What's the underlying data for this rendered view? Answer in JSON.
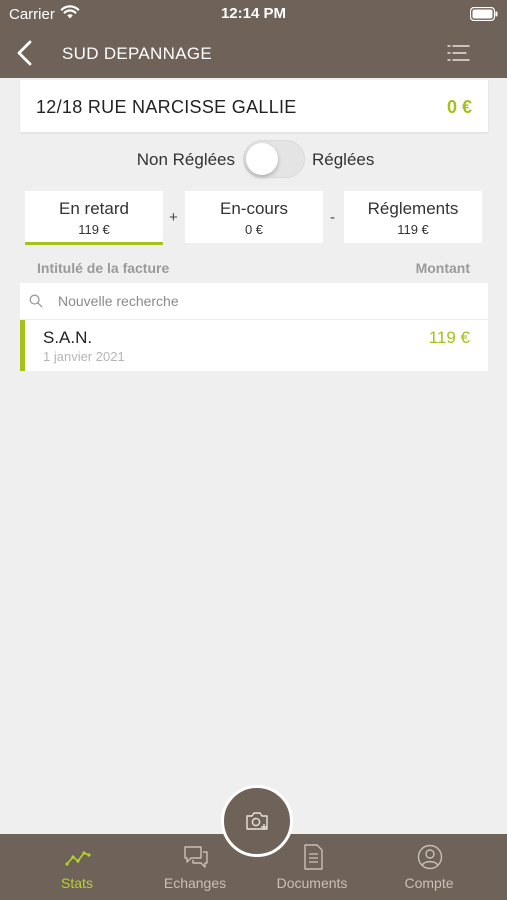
{
  "status_bar": {
    "carrier": "Carrier",
    "time": "12:14 PM"
  },
  "nav": {
    "title": "SUD DEPANNAGE",
    "icons": [
      "back-chevron-icon",
      "list-menu-icon"
    ]
  },
  "address": {
    "text": "12/18 RUE NARCISSE GALLIE",
    "amount": "0 €"
  },
  "filter_toggle": {
    "left_label": "Non Réglées",
    "right_label": "Réglées",
    "on": false
  },
  "tabs": [
    {
      "label": "En retard",
      "value": "119 €",
      "active": true
    },
    {
      "label": "En-cours",
      "value": "0 €",
      "active": false
    },
    {
      "label": "Réglements",
      "value": "119 €",
      "active": false
    }
  ],
  "tab_operators": [
    "+",
    "-"
  ],
  "columns": {
    "left": "Intitulé de la facture",
    "right": "Montant"
  },
  "search": {
    "placeholder": "Nouvelle recherche",
    "value": ""
  },
  "invoices": [
    {
      "title": "S.A.N.",
      "date": "1 janvier 2021",
      "amount": "119 €"
    }
  ],
  "bottom_nav": [
    {
      "label": "Stats",
      "icon": "stats-chart-icon",
      "active": true
    },
    {
      "label": "Echanges",
      "icon": "chat-bubbles-icon",
      "active": false
    },
    {
      "label": "Documents",
      "icon": "document-icon",
      "active": false
    },
    {
      "label": "Compte",
      "icon": "account-icon",
      "active": false
    }
  ],
  "fab": {
    "icon": "camera-add-icon"
  },
  "colors": {
    "header": "#6f6259",
    "accent": "#a6c01c",
    "background": "#efefef"
  }
}
